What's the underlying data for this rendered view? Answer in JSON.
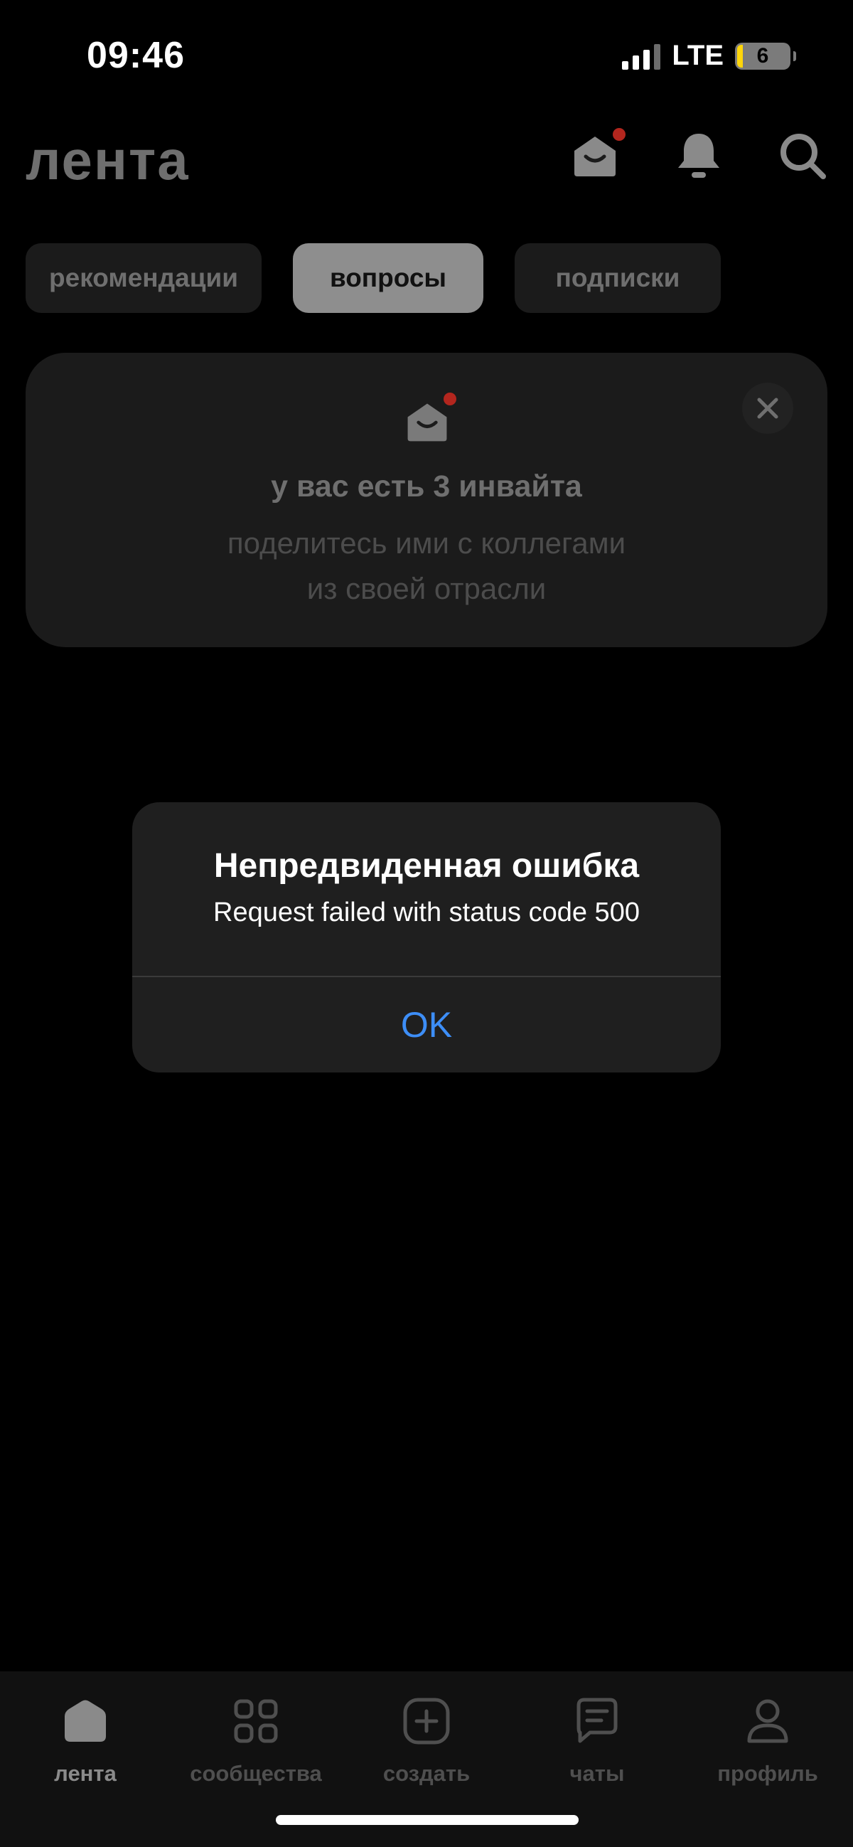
{
  "status_bar": {
    "time": "09:46",
    "network": "LTE",
    "battery": "6"
  },
  "header": {
    "logo": "лента",
    "icons": [
      "envelope-icon",
      "bell-icon",
      "search-icon"
    ],
    "notification_dot_color": "#b3261e"
  },
  "tabs": [
    {
      "label": "рекомендации",
      "active": false
    },
    {
      "label": "вопросы",
      "active": true
    },
    {
      "label": "подписки",
      "active": false
    }
  ],
  "invite_card": {
    "title": "у вас есть 3 инвайта",
    "subtitle_line1": "поделитесь ими с коллегами",
    "subtitle_line2": "из своей отрасли"
  },
  "alert": {
    "title": "Непредвиденная ошибка",
    "message": "Request failed with status code 500",
    "ok_label": "OK",
    "accent_color": "#3d8ef7"
  },
  "bottom_nav": [
    {
      "label": "лента",
      "icon": "home-icon",
      "active": true
    },
    {
      "label": "сообщества",
      "icon": "grid-icon",
      "active": false
    },
    {
      "label": "создать",
      "icon": "plus-square-icon",
      "active": false
    },
    {
      "label": "чаты",
      "icon": "chat-icon",
      "active": false
    },
    {
      "label": "профиль",
      "icon": "user-icon",
      "active": false
    }
  ]
}
